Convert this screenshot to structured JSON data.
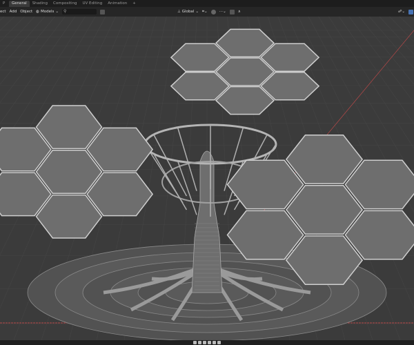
{
  "topbar": {
    "app_icon": "P",
    "tabs": [
      {
        "label": "General",
        "active": true
      },
      {
        "label": "Shading"
      },
      {
        "label": "Compositing"
      },
      {
        "label": "UV Editing"
      },
      {
        "label": "Animation"
      },
      {
        "label": "+"
      }
    ]
  },
  "header": {
    "menus": [
      "ect",
      "Add",
      "Object"
    ],
    "collection": "Models",
    "search_icon": "⚲",
    "transform_orientation": "Global"
  },
  "timeline": {
    "controls": [
      "jump-start",
      "prev-keyframe",
      "play-reverse",
      "play",
      "next-keyframe",
      "jump-end"
    ]
  },
  "colors": {
    "viewport": "#3b3b3b",
    "panel": "#6e6e6e",
    "axis_x": "#b84848",
    "accent": "#4772b3"
  }
}
